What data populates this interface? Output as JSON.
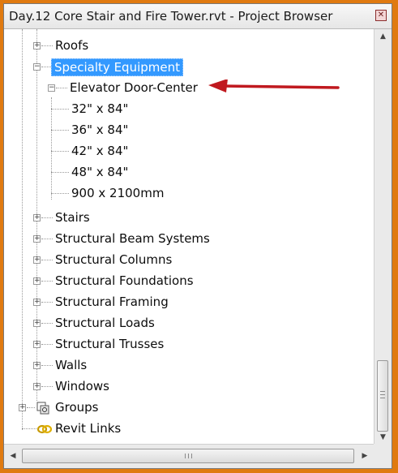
{
  "window": {
    "title": "Day.12 Core Stair and Fire Tower.rvt - Project Browser",
    "close_glyph": "✕"
  },
  "tree": {
    "roofs": "Roofs",
    "specialty_equipment": "Specialty Equipment",
    "elevator_door_center": "Elevator Door-Center",
    "types": [
      "32\" x 84\"",
      "36\" x 84\"",
      "42\" x 84\"",
      "48\" x 84\"",
      "900 x 2100mm"
    ],
    "stairs": "Stairs",
    "structural_beam_systems": "Structural Beam Systems",
    "structural_columns": "Structural Columns",
    "structural_foundations": "Structural Foundations",
    "structural_framing": "Structural Framing",
    "structural_loads": "Structural Loads",
    "structural_trusses": "Structural Trusses",
    "walls": "Walls",
    "windows": "Windows",
    "groups": "Groups",
    "revit_links": "Revit Links"
  },
  "scrollbar": {
    "up_glyph": "▲",
    "down_glyph": "▼",
    "left_glyph": "◀",
    "right_glyph": "▶"
  },
  "colors": {
    "frame": "#e07a10",
    "selection": "#3399ff",
    "arrow": "#c0191f"
  }
}
